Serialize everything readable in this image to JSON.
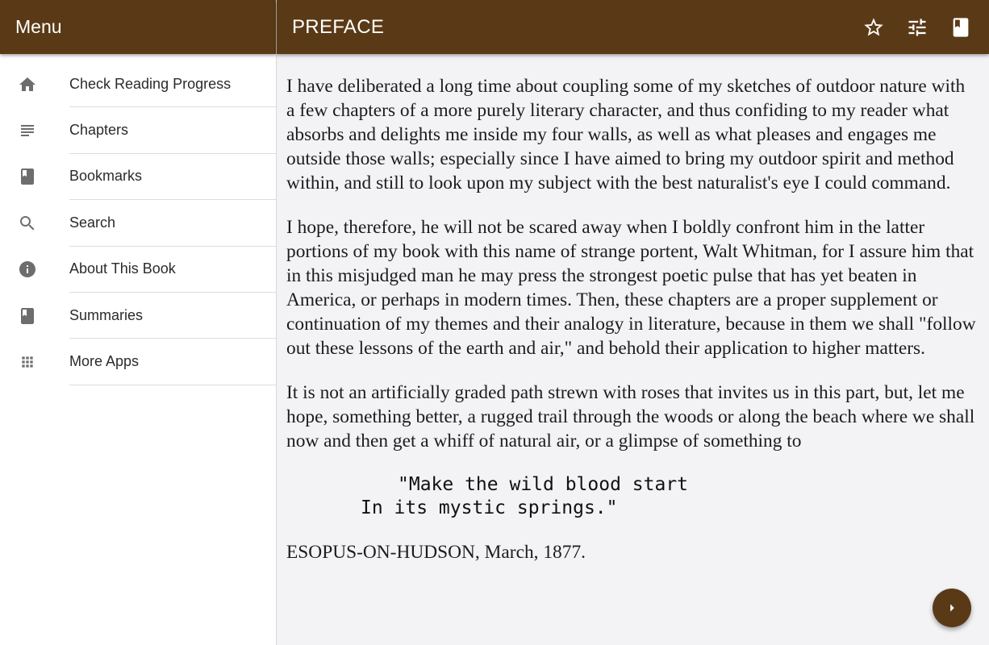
{
  "sidebar": {
    "title": "Menu",
    "items": [
      {
        "label": "Check Reading Progress",
        "icon": "home-icon"
      },
      {
        "label": "Chapters",
        "icon": "list-icon"
      },
      {
        "label": "Bookmarks",
        "icon": "book-icon"
      },
      {
        "label": "Search",
        "icon": "search-icon"
      },
      {
        "label": "About This Book",
        "icon": "info-icon"
      },
      {
        "label": "Summaries",
        "icon": "book-icon"
      },
      {
        "label": "More Apps",
        "icon": "grid-icon"
      }
    ]
  },
  "header": {
    "title": "PREFACE",
    "actions": [
      "star-icon",
      "tune-icon",
      "book-icon"
    ]
  },
  "content": {
    "paragraphs": [
      "I have deliberated a long time about coupling some of my sketches of outdoor nature with a few chapters of a more purely literary character, and thus confiding to my reader what absorbs and delights me inside my four walls, as well as what pleases and engages me outside those walls; especially since I have aimed to bring my outdoor spirit and method within, and still to look upon my subject with the best naturalist's eye I could command.",
      "I hope, therefore, he will not be scared away when I boldly confront him in the latter portions of my book with this name of strange portent, Walt Whitman, for I assure him that in this misjudged man he may press the strongest poetic pulse that has yet beaten in America, or perhaps in modern times. Then, these chapters are a proper supplement or continuation of my themes and their analogy in literature, because in them we shall \"follow out these lessons of the earth and air,\" and behold their application to higher matters.",
      "It is not an artificially graded path strewn with roses that invites us in this part, but, let me hope, something better, a rugged trail through the woods or along the beach where we shall now and then get a whiff of natural air, or a glimpse of something to"
    ],
    "verse_line_1": "\"Make the wild blood start",
    "verse_line_2": "In its mystic springs.\"",
    "signature": "ESOPUS-ON-HUDSON, March, 1877."
  },
  "fab": {
    "icon": "chevron-right-icon"
  },
  "colors": {
    "brand": "#5a3a16",
    "page_bg": "#f3f3f5"
  }
}
